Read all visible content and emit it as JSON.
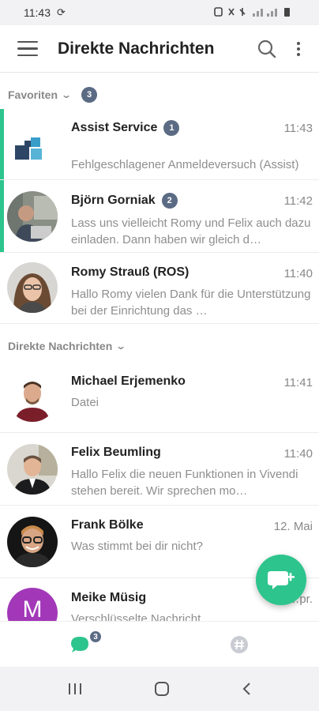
{
  "status_bar": {
    "time": "11:43",
    "sync_icon": "sync-icon",
    "right_icons": "⚇ ✱ ⚟ ▮▮▮ ▮"
  },
  "app_bar": {
    "title": "Direkte Nachrichten",
    "menu_icon": "hamburger-icon",
    "search_icon": "search-icon",
    "more_icon": "more-vert-icon"
  },
  "sections": {
    "favorites": {
      "label": "Favoriten",
      "count": "3"
    },
    "direct": {
      "label": "Direkte Nachrichten"
    }
  },
  "favorites": [
    {
      "name": "Assist Service",
      "unread": "1",
      "time": "11:43",
      "preview": "Fehlgeschlagener Anmeldeversuch (Assist)",
      "avatar": "assist-logo"
    },
    {
      "name": "Björn Gorniak",
      "unread": "2",
      "time": "11:42",
      "preview": "Lass uns vielleicht Romy und Felix auch dazu einladen. Dann haben wir gleich d…",
      "avatar": "photo"
    },
    {
      "name": "Romy Strauß (ROS)",
      "unread": "",
      "time": "11:40",
      "preview": "Hallo Romy vielen Dank für die Unterstützung bei der Einrichtung das …",
      "avatar": "photo"
    }
  ],
  "direct": [
    {
      "name": "Michael Erjemenko",
      "time": "11:41",
      "preview": "Datei",
      "avatar": "photo"
    },
    {
      "name": "Felix Beumling",
      "time": "11:40",
      "preview": "Hallo Felix die neuen Funktionen in Vivendi stehen bereit. Wir sprechen mo…",
      "avatar": "photo"
    },
    {
      "name": "Frank Bölke",
      "time": "12. Mai",
      "preview": "Was stimmt bei dir nicht?",
      "avatar": "photo"
    },
    {
      "name": "Meike Müsig",
      "time": "…pr.",
      "preview": "Verschlüsselte Nachricht",
      "avatar": "M"
    }
  ],
  "fab": {
    "icon": "new-chat-icon"
  },
  "bottom_nav": {
    "chats_badge": "3",
    "chats_icon": "chat-icon",
    "channels_icon": "hashtag-icon"
  },
  "colors": {
    "accent": "#2dc48d",
    "badge": "#5b6b84",
    "meike_avatar": "#a238b8"
  }
}
